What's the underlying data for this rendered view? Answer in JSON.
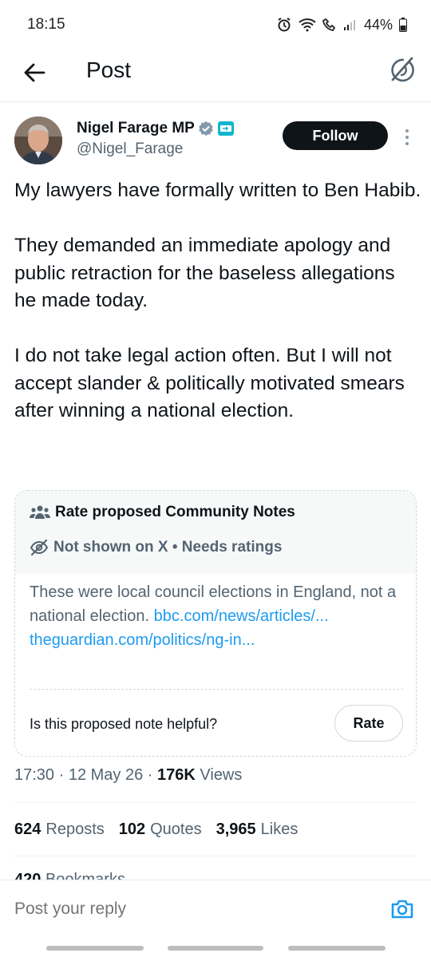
{
  "status_bar": {
    "time": "18:15",
    "battery": "44%",
    "icons": [
      "alarm-icon",
      "wifi-icon",
      "call-icon",
      "signal-icon",
      "battery-icon"
    ]
  },
  "header": {
    "title": "Post",
    "back_icon": "arrow-left-icon",
    "grok_icon": "grok-icon"
  },
  "author": {
    "name": "Nigel Farage MP",
    "handle": "@Nigel_Farage",
    "follow_label": "Follow",
    "verified_color": "#829aab",
    "affiliate_badge": "reform-uk-badge"
  },
  "tweet": {
    "paragraphs": [
      "My lawyers have formally written to Ben Habib.",
      "They demanded an immediate apology and public retraction for the baseless allegations he made today.",
      "I do not take legal action often. But I will not accept slander & politically motivated smears after winning a national election."
    ]
  },
  "community_note": {
    "heading": "Rate proposed Community Notes",
    "status": "Not shown on X • Needs ratings",
    "body_text": "These were local council elections in England, not a national election.",
    "link1": "bbc.com/news/articles/...",
    "link2": "theguardian.com/politics/ng-in...",
    "question": "Is this proposed note helpful?",
    "rate_label": "Rate"
  },
  "meta": {
    "time": "17:30",
    "date": "12 May 26",
    "views_count": "176K",
    "views_label": "Views"
  },
  "stats": {
    "reposts_count": "624",
    "reposts_label": "Reposts",
    "quotes_count": "102",
    "quotes_label": "Quotes",
    "likes_count": "3,965",
    "likes_label": "Likes",
    "bookmarks_count": "420",
    "bookmarks_label": "Bookmarks"
  },
  "reply": {
    "placeholder": "Post your reply"
  },
  "colors": {
    "accent": "#1d9bf0",
    "text": "#0f1419",
    "muted": "#536471"
  }
}
